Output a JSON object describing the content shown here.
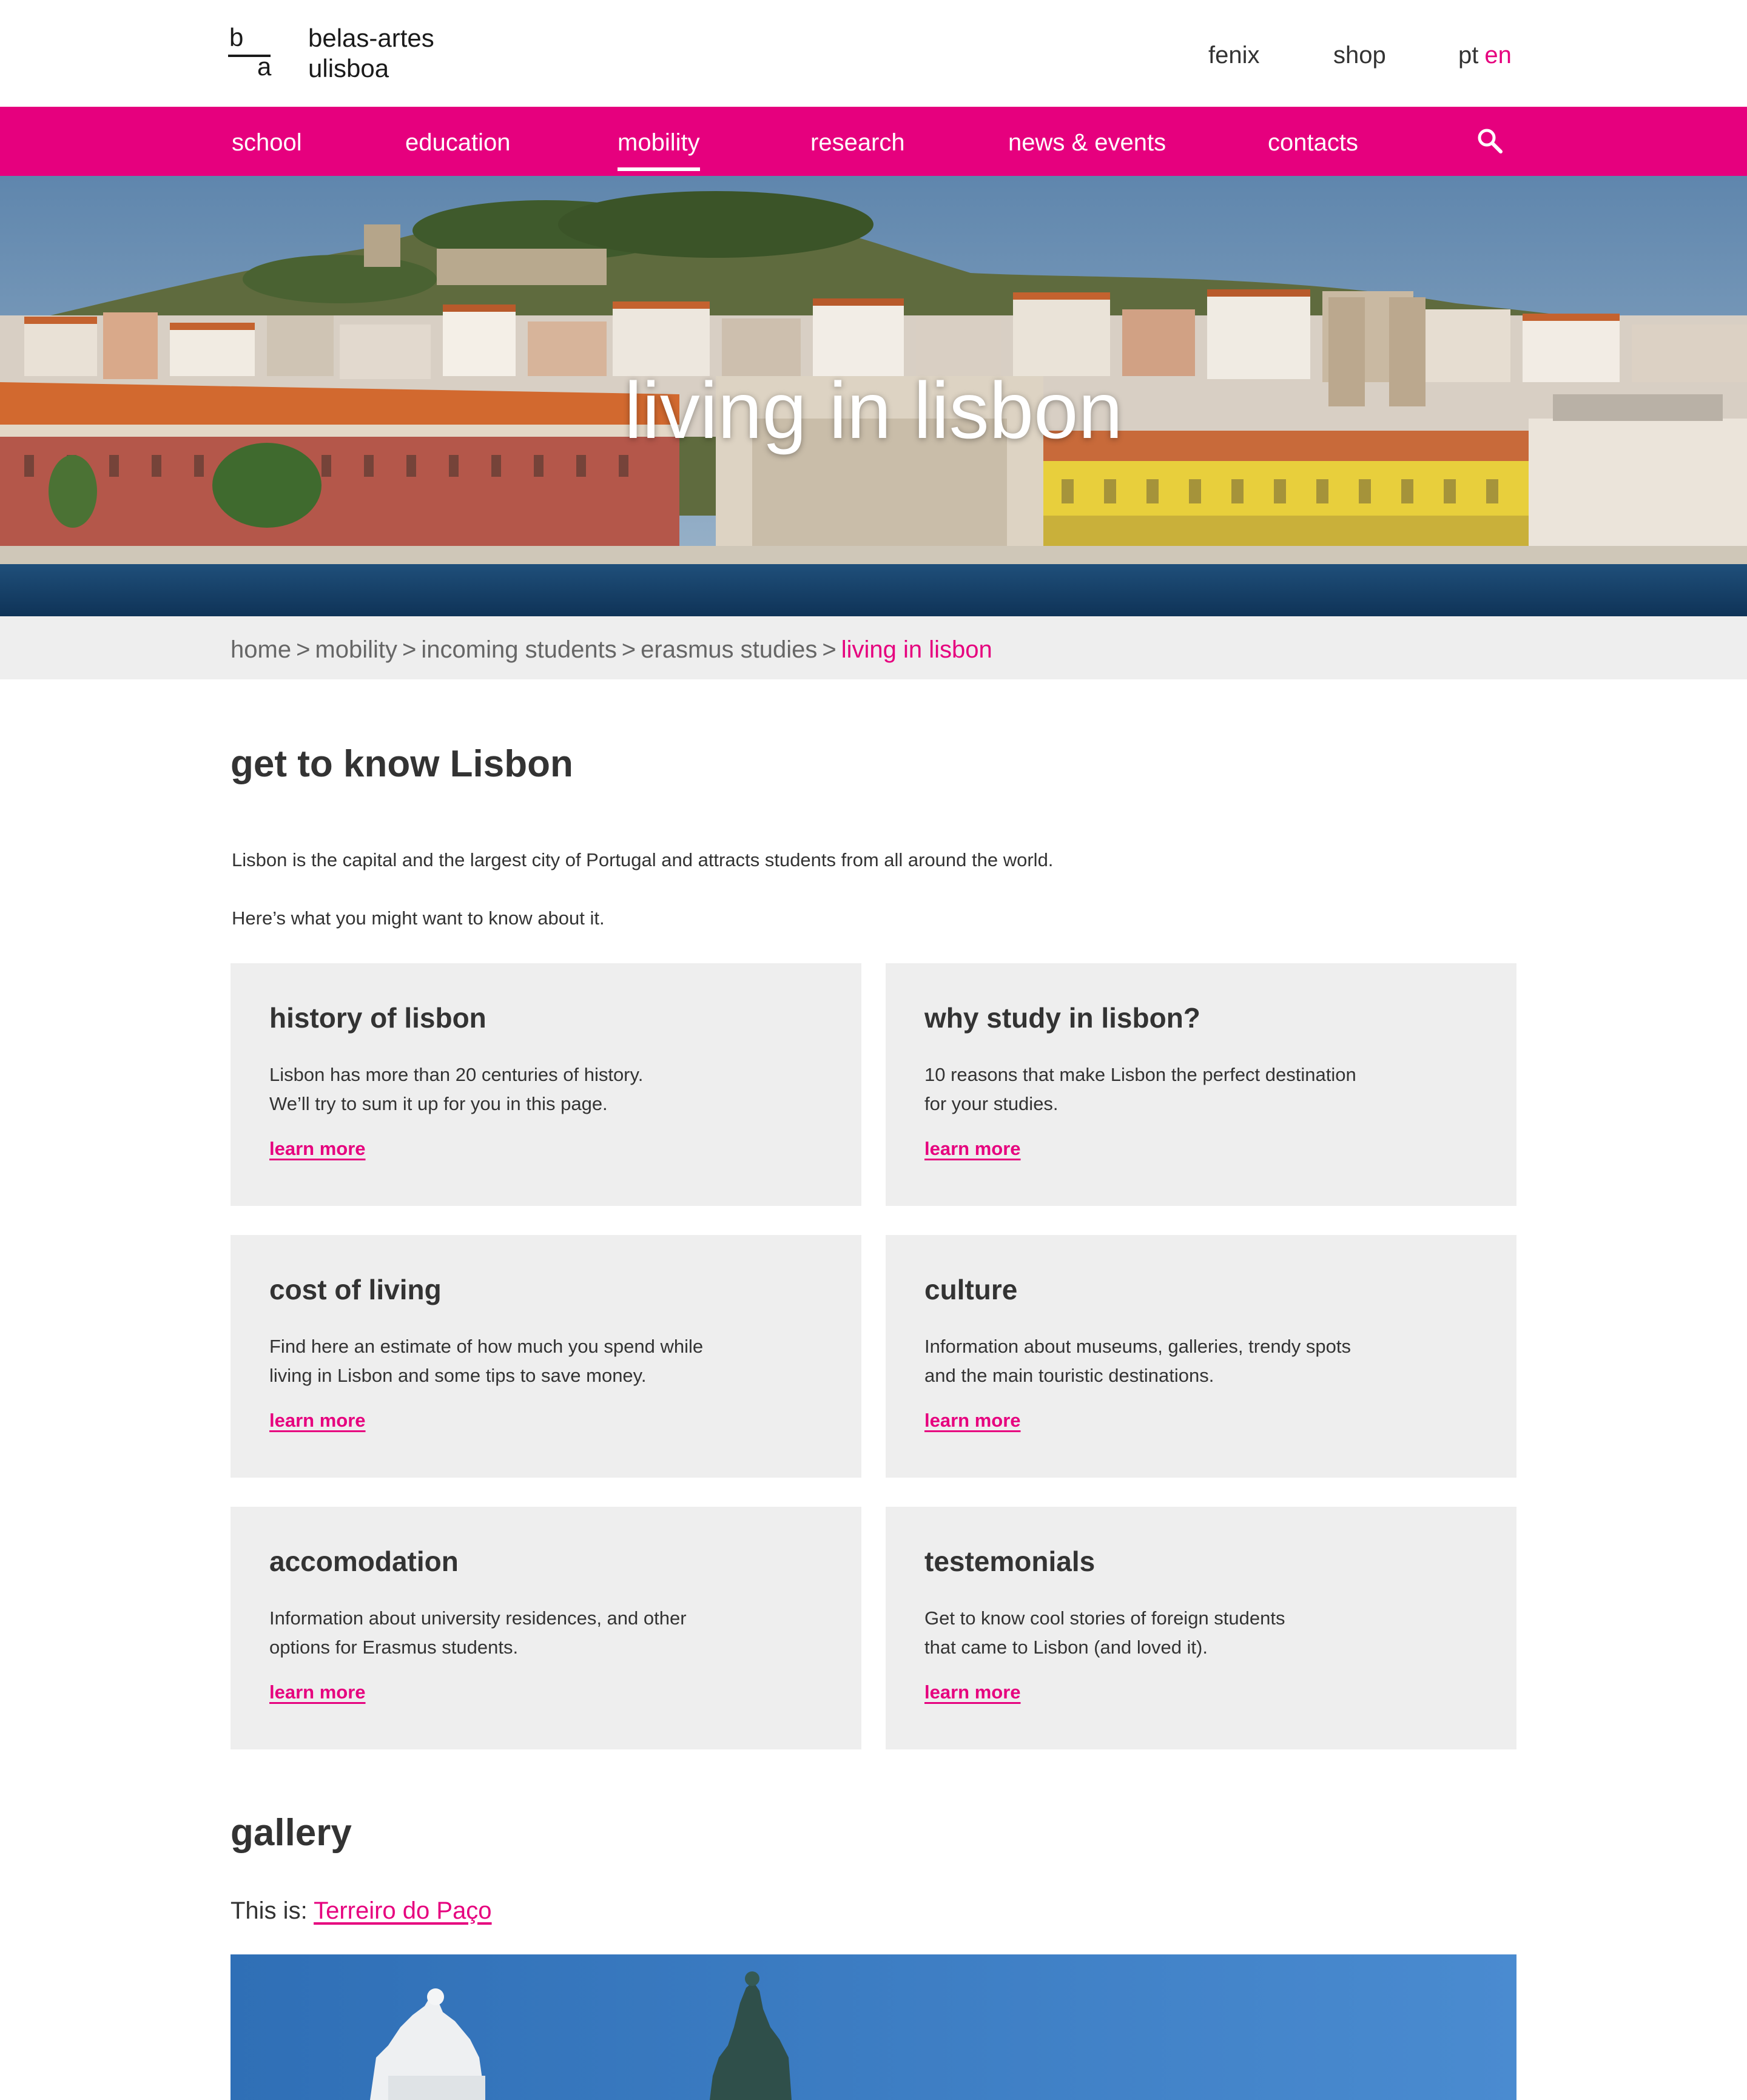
{
  "header": {
    "logo_mark_top": "b",
    "logo_mark_bottom": "a",
    "logo_line1": "belas-artes",
    "logo_line2": "ulisboa",
    "links": {
      "fenix": "fenix",
      "shop": "shop"
    },
    "lang": {
      "pt": "pt",
      "en": "en"
    }
  },
  "nav": {
    "items": [
      {
        "label": "school"
      },
      {
        "label": "education"
      },
      {
        "label": "mobility"
      },
      {
        "label": "research"
      },
      {
        "label": "news & events"
      },
      {
        "label": "contacts"
      }
    ],
    "active": "mobility",
    "search_icon": "search-icon"
  },
  "hero": {
    "title": "living in lisbon"
  },
  "breadcrumb": {
    "items": [
      "home",
      "mobility",
      "incoming students",
      "erasmus studies"
    ],
    "current": "living in lisbon",
    "separator": ">"
  },
  "intro": {
    "title": "get to know Lisbon",
    "paragraph1": "Lisbon is the capital and the largest city of Portugal and attracts students from all around the world.",
    "paragraph2": "Here’s what you might want to know about it."
  },
  "cards": [
    {
      "title": "history of lisbon",
      "text": "Lisbon has more than 20 centuries of history.\nWe’ll try to sum it up for you in this page.",
      "link": "learn more"
    },
    {
      "title": "why study in lisbon?",
      "text": "10 reasons that make Lisbon the perfect destination\nfor your studies.",
      "link": "learn more"
    },
    {
      "title": "cost of living",
      "text": "Find here an estimate of how much you spend while\nliving in Lisbon and some tips to save money.",
      "link": "learn more"
    },
    {
      "title": "culture",
      "text": "Information about museums, galleries, trendy spots\nand the main touristic destinations.",
      "link": "learn more"
    },
    {
      "title": "accomodation",
      "text": "Information about university residences, and other\noptions for Erasmus students.",
      "link": "learn more"
    },
    {
      "title": "testemonials",
      "text": "Get to know cool stories of foreign students\nthat came to Lisbon (and loved it).",
      "link": "learn more"
    }
  ],
  "gallery": {
    "title": "gallery",
    "caption_prefix": "This is:",
    "caption_link": "Terreiro do Paço"
  },
  "colors": {
    "accent": "#e6007e",
    "panel": "#eeeeee",
    "text": "#333333"
  }
}
